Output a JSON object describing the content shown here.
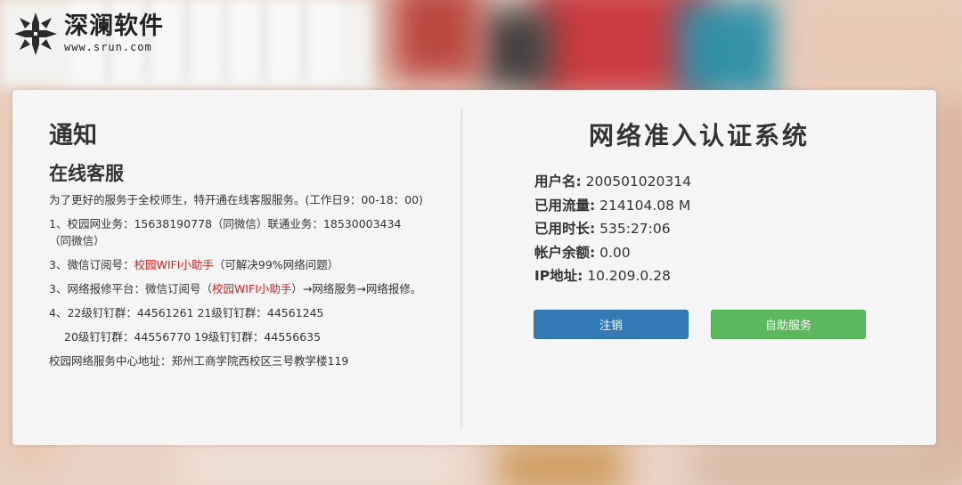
{
  "brand": {
    "name": "深澜软件",
    "url": "www.srun.com"
  },
  "notice": {
    "title": "通知",
    "subtitle": "在线客服",
    "lines": {
      "intro": "为了更好的服务于全校师生，特开通在线客服服务。(工作日9：00-18：00)",
      "l1": "1、校园网业务：15638190778（同微信）联通业务：18530003434（同微信）",
      "l2_prefix": "3、微信订阅号：",
      "l2_link": "校园WIFI小助手",
      "l2_suffix": "（可解决99%网络问题）",
      "l3_prefix": "3、网络报修平台：微信订阅号（",
      "l3_link": "校园WIFI小助手",
      "l3_suffix": "）→网络服务→网络报修。",
      "l4": "4、22级钉钉群：44561261 21级钉钉群：44561245",
      "l5": "20级钉钉群：44556770 19级钉钉群：44556635",
      "l6": "校园网络服务中心地址：郑州工商学院西校区三号教学楼119"
    }
  },
  "auth": {
    "title": "网络准入认证系统",
    "username_label": "用户名:",
    "username": "200501020314",
    "traffic_label": "已用流量:",
    "traffic": "214104.08 M",
    "duration_label": "已用时长:",
    "duration": "535:27:06",
    "balance_label": "帐户余额:",
    "balance": "0.00",
    "ip_label": "IP地址:",
    "ip": "10.209.0.28",
    "logout_label": "注销",
    "self_service_label": "自助服务"
  },
  "colors": {
    "primary": "#337ab7",
    "success": "#5cb85c",
    "link_red": "#e02020"
  }
}
